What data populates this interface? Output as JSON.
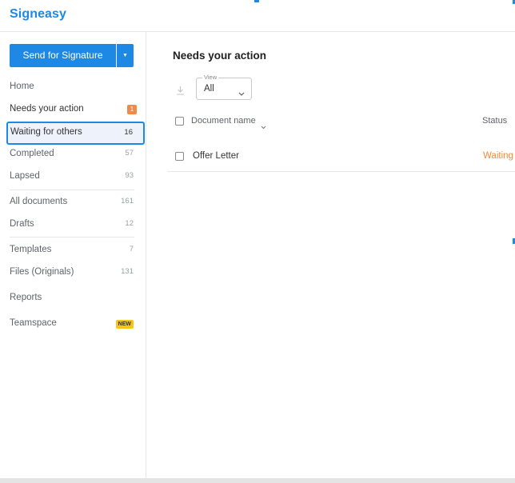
{
  "app": {
    "name": "Signeasy",
    "brand_color": "#1e88e5"
  },
  "sidebar": {
    "send_button_label": "Send for Signature",
    "send_dropdown_icon": "caret-down-icon",
    "items": [
      {
        "label": "Home",
        "count": ""
      },
      {
        "label": "Needs your action",
        "count": "1",
        "badge_color": "#f08a4b"
      },
      {
        "label": "Waiting for others",
        "count": "16",
        "active": true
      },
      {
        "label": "Completed",
        "count": "57"
      },
      {
        "label": "Lapsed",
        "count": "93"
      },
      {
        "label": "All documents",
        "count": "161"
      },
      {
        "label": "Drafts",
        "count": "12"
      },
      {
        "label": "Templates",
        "count": "7"
      },
      {
        "label": "Files (Originals)",
        "count": "131"
      },
      {
        "label": "Reports",
        "count": ""
      },
      {
        "label": "Teamspace",
        "badge": "NEW",
        "badge_color": "#f5c518"
      }
    ]
  },
  "main": {
    "title": "Needs your action",
    "download_icon": "download-icon",
    "view_filter": {
      "legend": "View",
      "value": "All"
    },
    "table": {
      "columns": [
        "Document name",
        "Status"
      ],
      "rows": [
        {
          "name": "Offer Letter",
          "status": "Waiting",
          "status_color": "#ef8a3a"
        }
      ]
    }
  }
}
